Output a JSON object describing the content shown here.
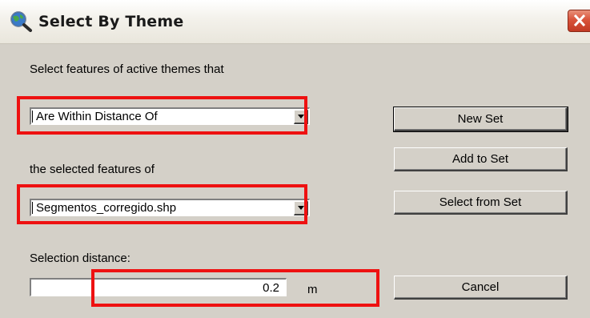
{
  "window": {
    "title": "Select By Theme",
    "close_label": "×"
  },
  "form": {
    "intro_label": "Select features of active themes that",
    "relation_select": {
      "value": "Are Within Distance Of"
    },
    "source_label": "the selected features of",
    "theme_select": {
      "value": "Segmentos_corregido.shp"
    },
    "distance_label": "Selection distance:",
    "distance_input": {
      "value": "0.2"
    },
    "distance_unit": "m"
  },
  "buttons": {
    "new_set": "New Set",
    "add_to_set": "Add to Set",
    "select_from_set": "Select from Set",
    "cancel": "Cancel"
  },
  "colors": {
    "dialog_bg": "#d4d0c8",
    "highlight_box": "#ee1111",
    "close_button": "#d9533b"
  },
  "icons": {
    "app": "globe-magnifier-icon",
    "close": "close-icon",
    "dropdown": "chevron-down-icon"
  }
}
